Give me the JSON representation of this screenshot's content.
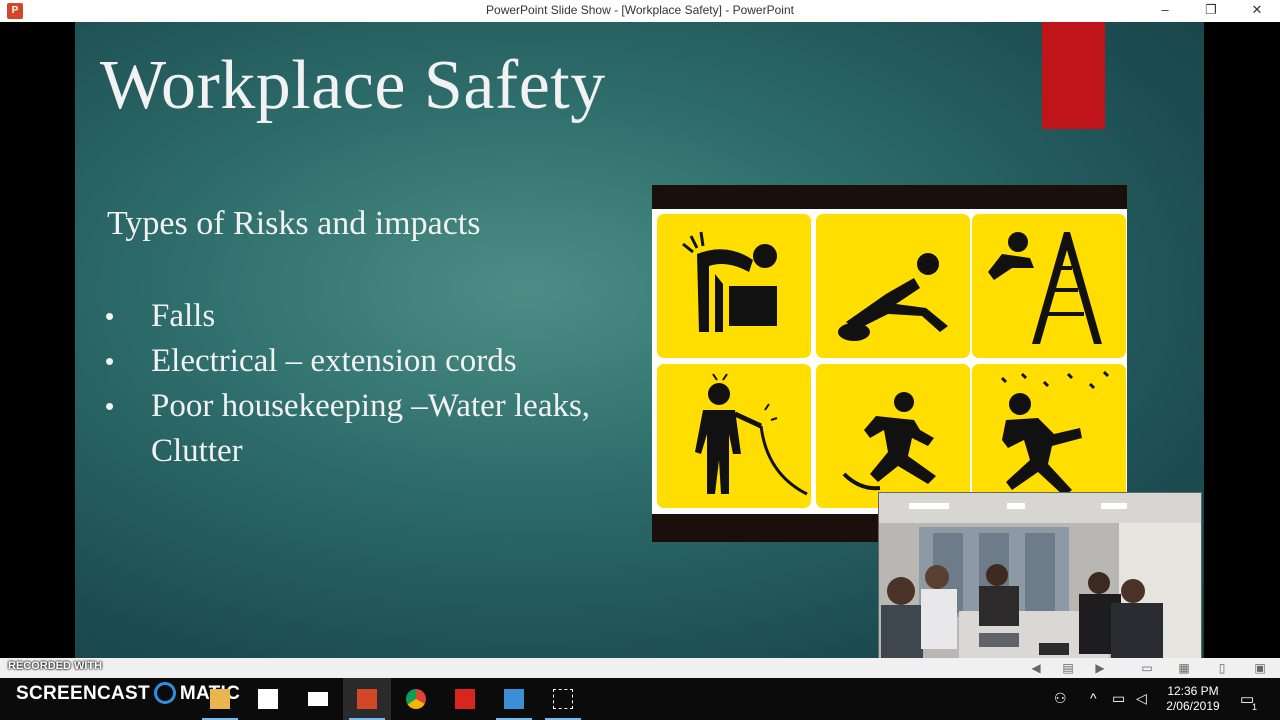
{
  "window": {
    "title": "PowerPoint Slide Show - [Workplace Safety] - PowerPoint",
    "app_icon": "P",
    "minimize": "–",
    "restore": "❐",
    "close": "✕"
  },
  "slide": {
    "title": "Workplace Safety",
    "subtitle": "Types of Risks and impacts",
    "bullet_symbol": "•",
    "bullets": [
      "Falls",
      "Electrical – extension cords",
      "Poor housekeeping –Water leaks, Clutter"
    ],
    "accent_color": "#c0141b",
    "picture_tiles": [
      "lifting-injury-icon",
      "trip-fall-icon",
      "ladder-fall-icon",
      "electric-shock-icon",
      "slip-icon",
      "wet-floor-slip-icon"
    ]
  },
  "recorder": {
    "watermark": "RECORDED WITH",
    "brand_left": "SCREENCAST",
    "brand_right": "MATIC"
  },
  "taskbar": {
    "time": "12:36 PM",
    "date": "2/06/2019",
    "notification_count": "1",
    "apps": [
      "windows-start",
      "search",
      "task-view",
      "file-explorer",
      "store",
      "mail",
      "powerpoint",
      "chrome",
      "acrobat",
      "photos",
      "snipping-tool"
    ]
  }
}
